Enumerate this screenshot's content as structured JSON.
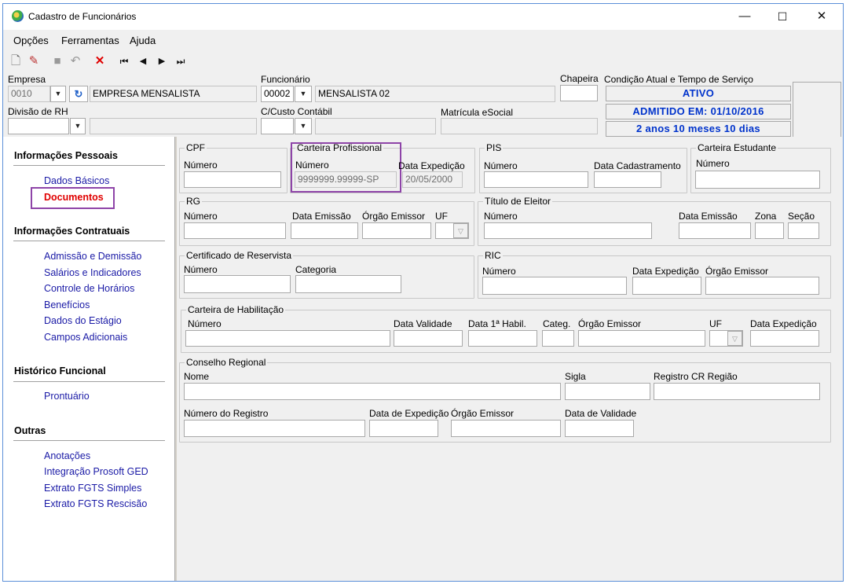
{
  "window": {
    "title": "Cadastro de Funcionários",
    "minimize": "—",
    "maximize": "☐",
    "close": "✕"
  },
  "menu": [
    "Opções",
    "Ferramentas",
    "Ajuda"
  ],
  "toolbar": {
    "icons": [
      "new-icon",
      "edit-icon",
      "save-icon",
      "undo-icon",
      "delete-icon",
      "first-icon",
      "prev-icon",
      "next-icon",
      "last-icon"
    ],
    "glyphs": [
      "🗋",
      "✎",
      "■",
      "↶",
      "✕",
      "⏮",
      "◀",
      "▶",
      "⏭"
    ]
  },
  "header": {
    "empresa_label": "Empresa",
    "empresa_code": "0010",
    "empresa_name": "EMPRESA MENSALISTA",
    "funcionario_label": "Funcionário",
    "funcionario_code": "00002",
    "funcionario_name": "MENSALISTA 02",
    "chapeira_label": "Chapeira",
    "condicao_label": "Condição Atual e Tempo de Serviço",
    "divisao_label": "Divisão de RH",
    "custo_label": "C/Custo Contábil",
    "matricula_label": "Matrícula eSocial",
    "status": "ATIVO",
    "admitido": "ADMITIDO EM: 01/10/2016",
    "tempo": "2 anos 10 meses 10 dias"
  },
  "sidebar": {
    "sections": [
      {
        "title": "Informações Pessoais",
        "items": [
          "Dados Básicos",
          "Documentos"
        ]
      },
      {
        "title": "Informações Contratuais",
        "items": [
          "Admissão e Demissão",
          "Salários e Indicadores",
          "Controle de Horários",
          "Benefícios",
          "Dados do Estágio",
          "Campos Adicionais"
        ]
      },
      {
        "title": "Histórico Funcional",
        "items": [
          "Prontuário"
        ]
      },
      {
        "title": "Outras",
        "items": [
          "Anotações",
          "Integração Prosoft GED",
          "Extrato FGTS Simples",
          "Extrato FGTS Rescisão"
        ]
      }
    ],
    "active": "Documentos"
  },
  "docs": {
    "cpf": {
      "title": "CPF",
      "numero": "Número"
    },
    "ctps": {
      "title": "Carteira Profissional",
      "numero": "Número",
      "numero_value": "9999999.99999-SP",
      "data_exp": "Data Expedição",
      "data_exp_value": "20/05/2000"
    },
    "pis": {
      "title": "PIS",
      "numero": "Número",
      "data_cad": "Data Cadastramento"
    },
    "estudante": {
      "title": "Carteira Estudante",
      "numero": "Número"
    },
    "rg": {
      "title": "RG",
      "numero": "Número",
      "data_em": "Data Emissão",
      "orgao": "Órgão Emissor",
      "uf": "UF"
    },
    "titulo": {
      "title": "Título de Eleitor",
      "numero": "Número",
      "data_em": "Data Emissão",
      "zona": "Zona",
      "secao": "Seção"
    },
    "reservista": {
      "title": "Certificado de Reservista",
      "numero": "Número",
      "categoria": "Categoria"
    },
    "ric": {
      "title": "RIC",
      "numero": "Número",
      "data_exp": "Data Expedição",
      "orgao": "Órgão Emissor"
    },
    "cnh": {
      "title": "Carteira de Habilitação",
      "numero": "Número",
      "validade": "Data Validade",
      "primeira": "Data 1ª Habil.",
      "categ": "Categ.",
      "orgao": "Órgão Emissor",
      "uf": "UF",
      "data_exp": "Data Expedição"
    },
    "conselho": {
      "title": "Conselho Regional",
      "nome": "Nome",
      "sigla": "Sigla",
      "registro_regiao": "Registro CR Região",
      "num_registro": "Número do Registro",
      "data_exp": "Data de Expedição",
      "orgao": "Órgão Emissor",
      "validade": "Data de Validade"
    }
  }
}
